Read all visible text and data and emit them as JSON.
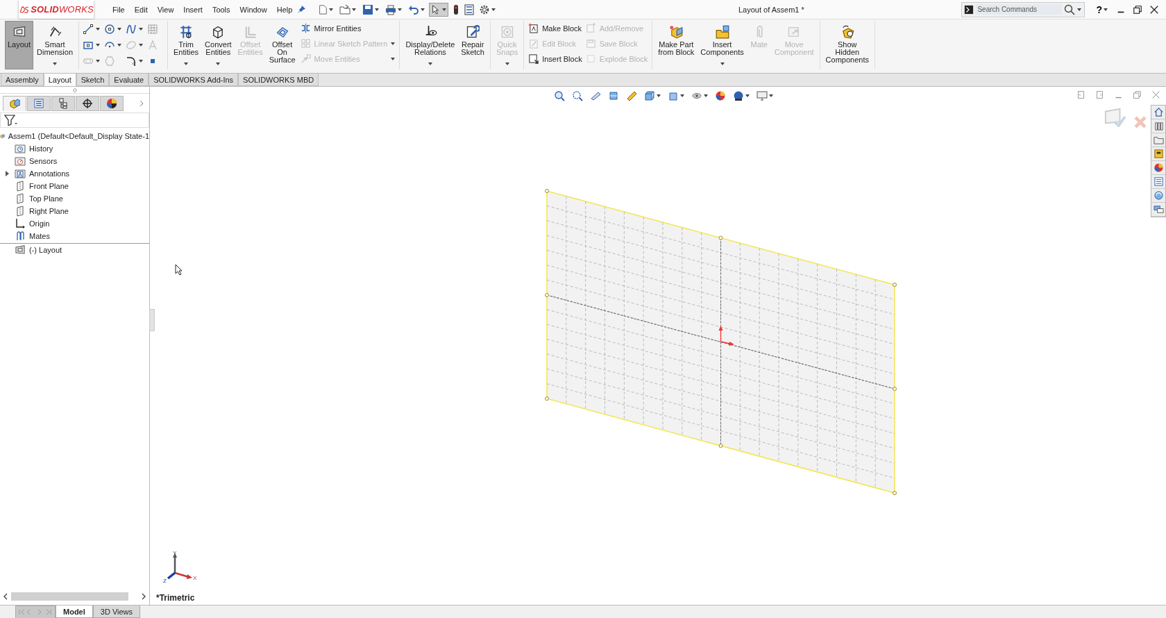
{
  "app": {
    "logo": "**SOLID**WORKS",
    "menu": [
      "File",
      "Edit",
      "View",
      "Insert",
      "Tools",
      "Window",
      "Help"
    ],
    "title": "Layout of Assem1 *",
    "search": {
      "placeholder": "Search Commands"
    },
    "help": "?"
  },
  "ribbon": [
    [
      {
        "kind": "large",
        "label": "Layout",
        "pressed": true,
        "disabled": false,
        "dropdown": false
      },
      {
        "kind": "large",
        "label": "Smart\nDimension",
        "pressed": false,
        "disabled": false,
        "dropdown": true
      }
    ],
    [
      {
        "kind": "sketch-grid",
        "tools": [
          {
            "disabled": false,
            "dropdown": true
          },
          {
            "disabled": false,
            "dropdown": true
          },
          {
            "disabled": false,
            "dropdown": true
          },
          {
            "disabled": false,
            "dropdown": false
          },
          {
            "disabled": false,
            "dropdown": true
          },
          {
            "disabled": false,
            "dropdown": true
          },
          {
            "disabled": true,
            "dropdown": true
          },
          {
            "disabled": true,
            "dropdown": false
          },
          {
            "disabled": true,
            "dropdown": true
          },
          {
            "disabled": true,
            "dropdown": false
          },
          {
            "disabled": false,
            "dropdown": true
          },
          {
            "disabled": false,
            "dropdown": false
          }
        ]
      }
    ],
    [
      {
        "kind": "large",
        "label": "Trim\nEntities",
        "pressed": false,
        "disabled": false,
        "dropdown": true
      },
      {
        "kind": "large",
        "label": "Convert\nEntities",
        "pressed": false,
        "disabled": false,
        "dropdown": true
      },
      {
        "kind": "large",
        "label": "Offset\nEntities",
        "pressed": false,
        "disabled": true,
        "dropdown": false
      },
      {
        "kind": "large",
        "label": "Offset\nOn\nSurface",
        "pressed": false,
        "disabled": false,
        "dropdown": false
      },
      {
        "kind": "stack",
        "items": [
          {
            "label": "Mirror Entities",
            "disabled": false,
            "dropdown": false
          },
          {
            "label": "Linear Sketch Pattern",
            "disabled": true,
            "dropdown": true
          },
          {
            "label": "Move Entities",
            "disabled": true,
            "dropdown": true
          }
        ]
      }
    ],
    [
      {
        "kind": "large",
        "label": "Display/Delete\nRelations",
        "pressed": false,
        "disabled": false,
        "dropdown": true
      },
      {
        "kind": "large",
        "label": "Repair\nSketch",
        "pressed": false,
        "disabled": false,
        "dropdown": false
      }
    ],
    [
      {
        "kind": "large",
        "label": "Quick\nSnaps",
        "pressed": false,
        "disabled": true,
        "dropdown": true
      }
    ],
    [
      {
        "kind": "stack",
        "items": [
          {
            "label": "Make Block",
            "disabled": false,
            "dropdown": false
          },
          {
            "label": "Edit Block",
            "disabled": true,
            "dropdown": false
          },
          {
            "label": "Insert Block",
            "disabled": false,
            "dropdown": false
          }
        ]
      },
      {
        "kind": "stack",
        "items": [
          {
            "label": "Add/Remove",
            "disabled": true,
            "dropdown": false
          },
          {
            "label": "Save Block",
            "disabled": true,
            "dropdown": false
          },
          {
            "label": "Explode Block",
            "disabled": true,
            "dropdown": false
          }
        ]
      }
    ],
    [
      {
        "kind": "large",
        "label": "Make Part\nfrom Block",
        "pressed": false,
        "disabled": false,
        "dropdown": false
      },
      {
        "kind": "large",
        "label": "Insert\nComponents",
        "pressed": false,
        "disabled": false,
        "dropdown": true
      },
      {
        "kind": "large",
        "label": "Mate",
        "pressed": false,
        "disabled": true,
        "dropdown": false
      },
      {
        "kind": "large",
        "label": "Move\nComponent",
        "pressed": false,
        "disabled": true,
        "dropdown": false
      }
    ],
    [
      {
        "kind": "large",
        "label": "Show\nHidden\nComponents",
        "pressed": false,
        "disabled": false,
        "dropdown": false
      }
    ]
  ],
  "command_tabs": [
    {
      "label": "Assembly",
      "selected": false
    },
    {
      "label": "Layout",
      "selected": true
    },
    {
      "label": "Sketch",
      "selected": false
    },
    {
      "label": "Evaluate",
      "selected": false
    },
    {
      "label": "SOLIDWORKS Add-Ins",
      "selected": false
    },
    {
      "label": "SOLIDWORKS MBD",
      "selected": false
    }
  ],
  "panel_tabs": [
    {
      "selected": true
    },
    {
      "selected": false
    },
    {
      "selected": false
    },
    {
      "selected": false
    },
    {
      "selected": false
    }
  ],
  "tree": {
    "root": {
      "label": "Assem1  (Default<Default_Display State-1",
      "children": [
        {
          "label": "History",
          "expandable": false
        },
        {
          "label": "Sensors",
          "expandable": false
        },
        {
          "label": "Annotations",
          "expandable": true
        },
        {
          "label": "Front Plane",
          "expandable": false
        },
        {
          "label": "Top Plane",
          "expandable": false
        },
        {
          "label": "Right Plane",
          "expandable": false
        },
        {
          "label": "Origin",
          "expandable": false
        },
        {
          "label": "Mates",
          "expandable": false
        },
        {
          "label": "(-) Layout",
          "expandable": false
        }
      ]
    }
  },
  "viewport": {
    "view_label": "*Trimetric",
    "triad": {
      "x": "X",
      "y": "Y",
      "z": "Z"
    }
  },
  "bottom_tabs": [
    {
      "label": "Model",
      "selected": true
    },
    {
      "label": "3D Views",
      "selected": false
    }
  ]
}
